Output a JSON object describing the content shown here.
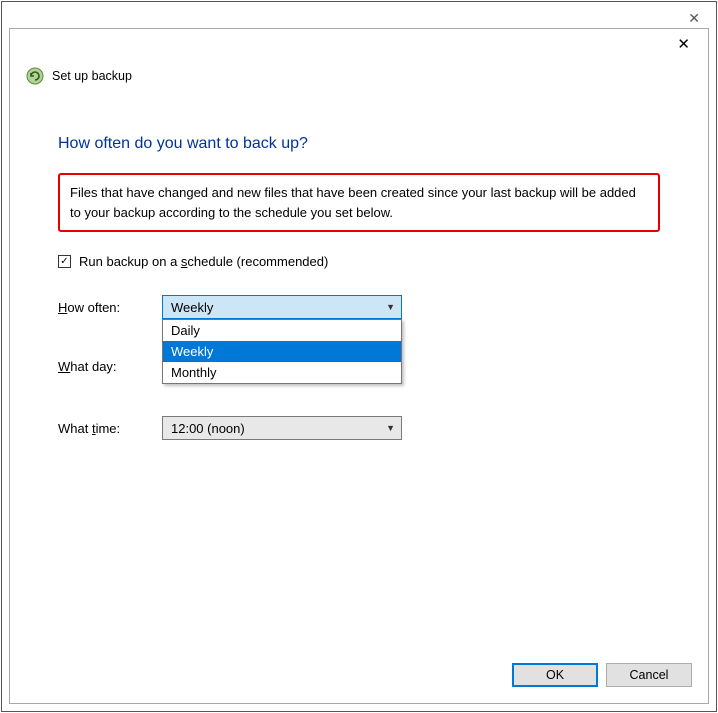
{
  "window": {
    "title": "Set up backup"
  },
  "main": {
    "heading": "How often do you want to back up?",
    "description": "Files that have changed and new files that have been created since your last backup will be added to your backup according to the schedule you set below."
  },
  "schedule_checkbox": {
    "checked": true,
    "label": "Run backup on a schedule (recommended)"
  },
  "fields": {
    "how_often": {
      "label": "How often:",
      "value": "Weekly",
      "options": [
        "Daily",
        "Weekly",
        "Monthly"
      ],
      "open": true
    },
    "what_day": {
      "label": "What day:",
      "value": ""
    },
    "what_time": {
      "label": "What time:",
      "value": "12:00 (noon)"
    }
  },
  "buttons": {
    "ok": "OK",
    "cancel": "Cancel"
  }
}
